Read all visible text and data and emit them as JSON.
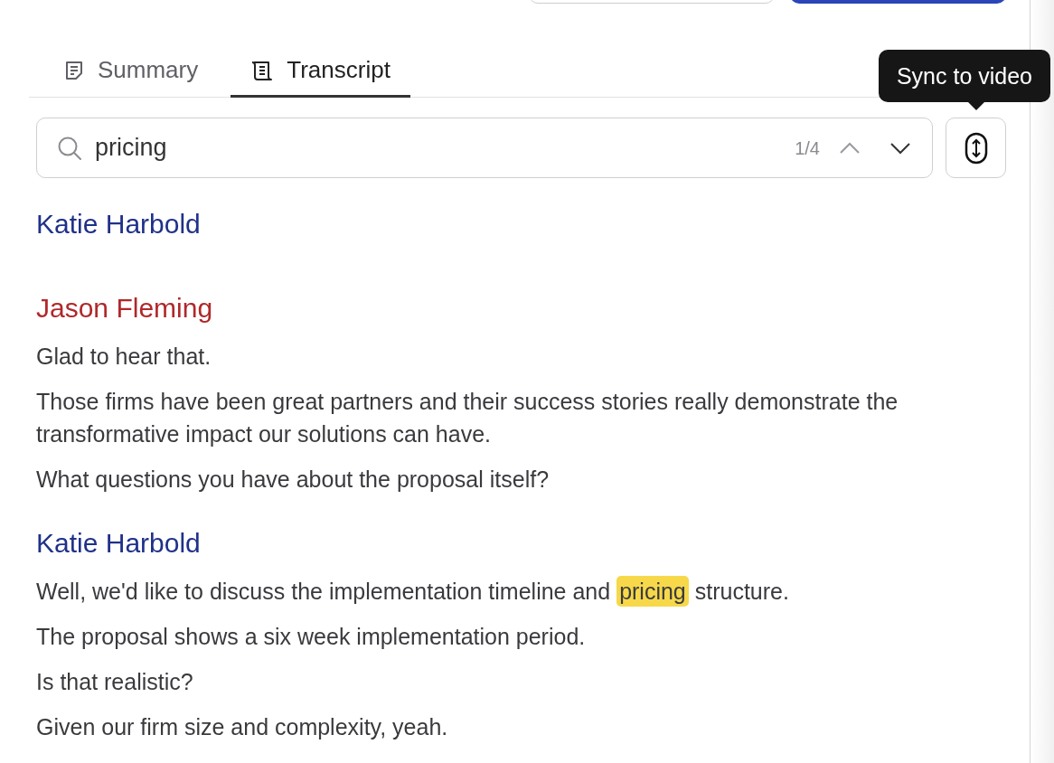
{
  "tabs": [
    {
      "label": "Summary",
      "selected": false
    },
    {
      "label": "Transcript",
      "selected": true
    }
  ],
  "tooltip": {
    "text": "Sync to video"
  },
  "search": {
    "value": "pricing",
    "counter": "1/4"
  },
  "transcript": [
    {
      "speaker": "Katie Harbold",
      "color": "#1f3189"
    },
    {
      "speaker": "Jason Fleming",
      "color": "#b0282a",
      "lines": [
        "Glad to hear that.",
        "Those firms have been great partners and their success stories really demonstrate the transformative impact our solutions can have.",
        "What questions you have about the proposal itself?"
      ]
    },
    {
      "speaker": "Katie Harbold",
      "color": "#1f3189",
      "lines": [
        {
          "parts": [
            {
              "text": "Well, we'd like to discuss the implementation timeline and ",
              "highlight": false
            },
            {
              "text": "pricing",
              "highlight": true
            },
            {
              "text": " structure.",
              "highlight": false
            }
          ]
        },
        "The proposal shows a six week implementation period.",
        "Is that realistic?",
        "Given our firm size and complexity, yeah."
      ]
    }
  ]
}
